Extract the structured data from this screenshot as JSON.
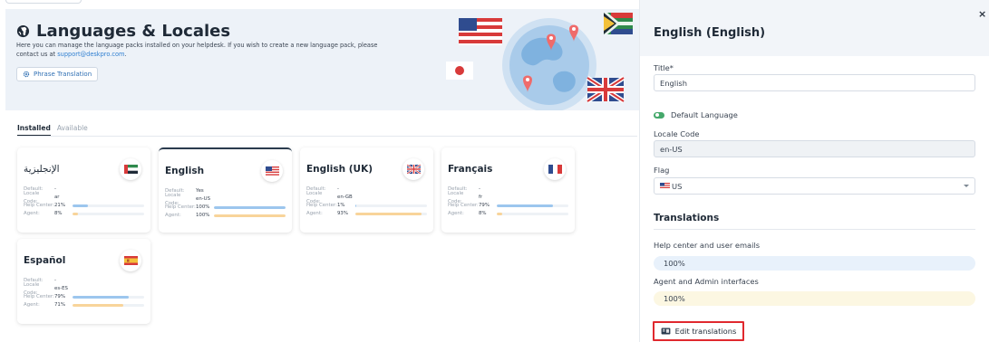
{
  "main": {
    "title": "Languages & Locales",
    "description_prefix": "Here you can manage the language packs installed on your helpdesk. If you wish to create a new language pack, please contact us at ",
    "support_email": "support@deskpro.com",
    "description_suffix": ".",
    "phrase_button": "Phrase Translation",
    "tabs": {
      "installed": "Installed",
      "available": "Available"
    },
    "row_labels": {
      "default": "Default:",
      "locale_code": "Locale Code:",
      "help_center": "Help Center:",
      "agent": "Agent:"
    },
    "cards": [
      {
        "name": "الإنجليزية",
        "flag": "AE",
        "default": "-",
        "locale": "ar",
        "help_pct": "21%",
        "help": 0.21,
        "agent_pct": "8%",
        "agent": 0.08,
        "active": false
      },
      {
        "name": "English",
        "flag": "US",
        "default": "Yes",
        "locale": "en-US",
        "help_pct": "100%",
        "help": 1.0,
        "agent_pct": "100%",
        "agent": 1.0,
        "active": true
      },
      {
        "name": "English (UK)",
        "flag": "GB",
        "default": "-",
        "locale": "en-GB",
        "help_pct": "1%",
        "help": 0.01,
        "agent_pct": "93%",
        "agent": 0.93,
        "active": false
      },
      {
        "name": "Français",
        "flag": "FR",
        "default": "-",
        "locale": "fr",
        "help_pct": "79%",
        "help": 0.79,
        "agent_pct": "8%",
        "agent": 0.08,
        "active": false
      },
      {
        "name": "Español",
        "flag": "ES",
        "default": "-",
        "locale": "es-ES",
        "help_pct": "79%",
        "help": 0.79,
        "agent_pct": "71%",
        "agent": 0.71,
        "active": false
      }
    ]
  },
  "panel": {
    "title": "English (English)",
    "close": "×",
    "title_label": "Title*",
    "title_value": "English",
    "default_language": "Default Language",
    "locale_label": "Locale Code",
    "locale_value": "en-US",
    "flag_label": "Flag",
    "flag_value": "US",
    "translations_heading": "Translations",
    "help_label": "Help center and user emails",
    "help_value": "100%",
    "agent_label": "Agent and Admin interfaces",
    "agent_value": "100%",
    "edit_button": "Edit translations"
  },
  "colors": {
    "bar_help": "#9cc6ee",
    "bar_agent": "#f8d49a",
    "highlight": "#e0282e",
    "toggle_on": "#45a86b"
  }
}
